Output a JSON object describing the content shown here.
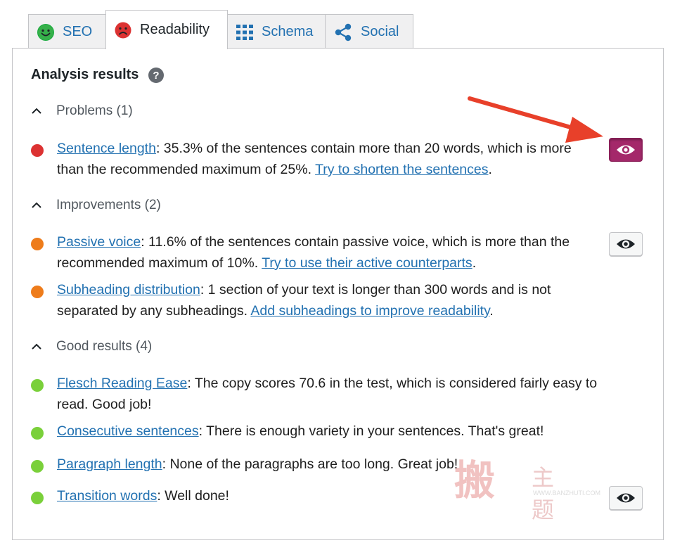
{
  "tabs": [
    {
      "label": "SEO",
      "icon": "smiley-green-icon"
    },
    {
      "label": "Readability",
      "icon": "sad-red-icon"
    },
    {
      "label": "Schema",
      "icon": "grid-icon"
    },
    {
      "label": "Social",
      "icon": "share-icon"
    }
  ],
  "analysis": {
    "heading": "Analysis results",
    "problems": {
      "title": "Problems (1)",
      "items": [
        {
          "link": "Sentence length",
          "text": ": 35.3% of the sentences contain more than 20 words, which is more than the recommended maximum of 25%. ",
          "action": "Try to shorten the sentences",
          "end": "."
        }
      ]
    },
    "improvements": {
      "title": "Improvements (2)",
      "items": [
        {
          "link": "Passive voice",
          "text": ": 11.6% of the sentences contain passive voice, which is more than the recommended maximum of 10%. ",
          "action": "Try to use their active counterparts",
          "end": "."
        },
        {
          "link": "Subheading distribution",
          "text": ": 1 section of your text is longer than 300 words and is not separated by any subheadings. ",
          "action": "Add subheadings to improve readability",
          "end": "."
        }
      ]
    },
    "good": {
      "title": "Good results (4)",
      "items": [
        {
          "link": "Flesch Reading Ease",
          "text": ": The copy scores 70.6 in the test, which is considered fairly easy to read. Good job!"
        },
        {
          "link": "Consecutive sentences",
          "text": ": There is enough variety in your sentences. That's great!"
        },
        {
          "link": "Paragraph length",
          "text": ": None of the paragraphs are too long. Great job!"
        },
        {
          "link": "Transition words",
          "text": ": Well done!"
        }
      ]
    }
  },
  "colors": {
    "problem": "#dc3232",
    "improvement": "#ee7c1b",
    "good": "#7ad03a",
    "link": "#2271b1",
    "active_eye": "#a4286a",
    "arrow": "#e8402a"
  },
  "watermark": {
    "logo": "搬",
    "text": "主题",
    "url": "WWW.BANZHUTI.COM"
  }
}
